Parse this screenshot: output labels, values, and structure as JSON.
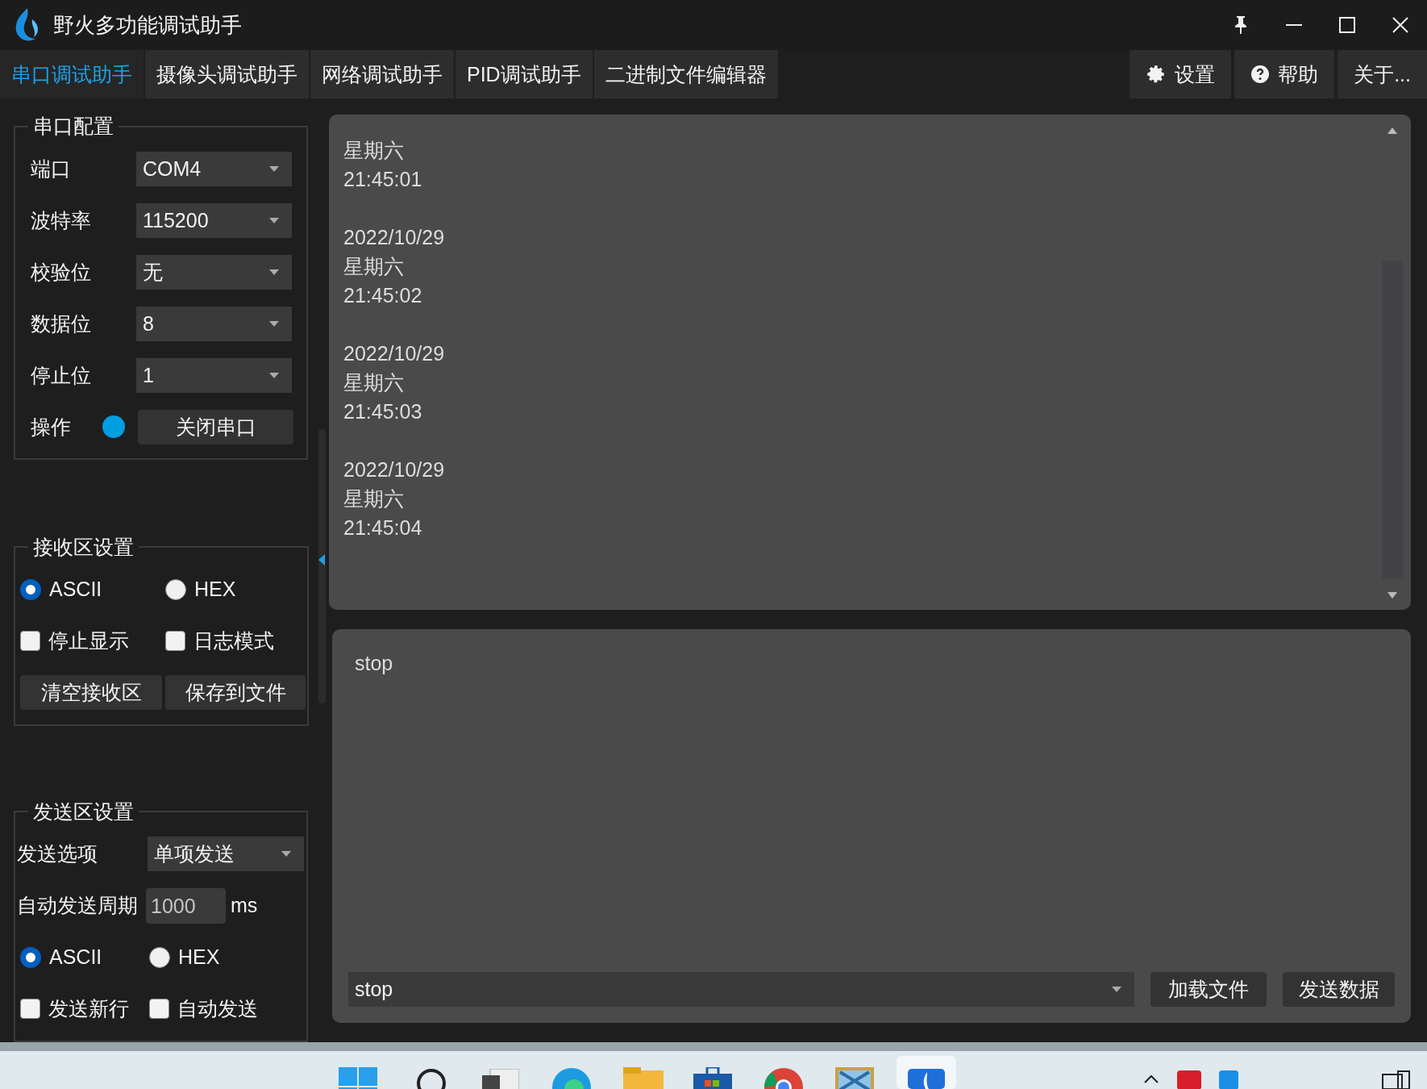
{
  "window": {
    "title": "野火多功能调试助手"
  },
  "tabs": [
    {
      "label": "串口调试助手",
      "selected": true
    },
    {
      "label": "摄像头调试助手",
      "selected": false
    },
    {
      "label": "网络调试助手",
      "selected": false
    },
    {
      "label": "PID调试助手",
      "selected": false
    },
    {
      "label": "二进制文件编辑器",
      "selected": false
    }
  ],
  "toolbar_buttons": [
    {
      "label": "设置",
      "kind": "gear"
    },
    {
      "label": "帮助",
      "kind": "help"
    },
    {
      "label": "关于...",
      "kind": "plain"
    }
  ],
  "serial_config": {
    "title": "串口配置",
    "fields": [
      {
        "label": "端口",
        "value": "COM4"
      },
      {
        "label": "波特率",
        "value": "115200"
      },
      {
        "label": "校验位",
        "value": "无"
      },
      {
        "label": "数据位",
        "value": "8"
      },
      {
        "label": "停止位",
        "value": "1"
      }
    ],
    "operation": {
      "label": "操作",
      "open": true,
      "button": "关闭串口"
    }
  },
  "receive_settings": {
    "title": "接收区设置",
    "modes": [
      {
        "label": "ASCII",
        "selected": true
      },
      {
        "label": "HEX",
        "selected": false
      }
    ],
    "options": [
      {
        "label": "停止显示",
        "checked": false
      },
      {
        "label": "日志模式",
        "checked": false
      }
    ],
    "buttons": [
      "清空接收区",
      "保存到文件"
    ]
  },
  "send_settings": {
    "title": "发送区设置",
    "send_option": {
      "label": "发送选项",
      "value": "单项发送"
    },
    "auto_period": {
      "label": "自动发送周期",
      "value": "1000",
      "unit": "ms"
    },
    "modes": [
      {
        "label": "ASCII",
        "selected": true
      },
      {
        "label": "HEX",
        "selected": false
      }
    ],
    "options": [
      {
        "label": "发送新行",
        "checked": false
      },
      {
        "label": "自动发送",
        "checked": false
      }
    ]
  },
  "receive_area": {
    "entries": [
      [
        "星期六",
        "21:45:01"
      ],
      [
        "2022/10/29",
        "星期六",
        "21:45:02"
      ],
      [
        "2022/10/29",
        "星期六",
        "21:45:03"
      ],
      [
        "2022/10/29",
        "星期六",
        "21:45:04"
      ]
    ]
  },
  "send_area": {
    "text": "stop",
    "history_value": "stop",
    "buttons": [
      "加载文件",
      "发送数据"
    ]
  }
}
